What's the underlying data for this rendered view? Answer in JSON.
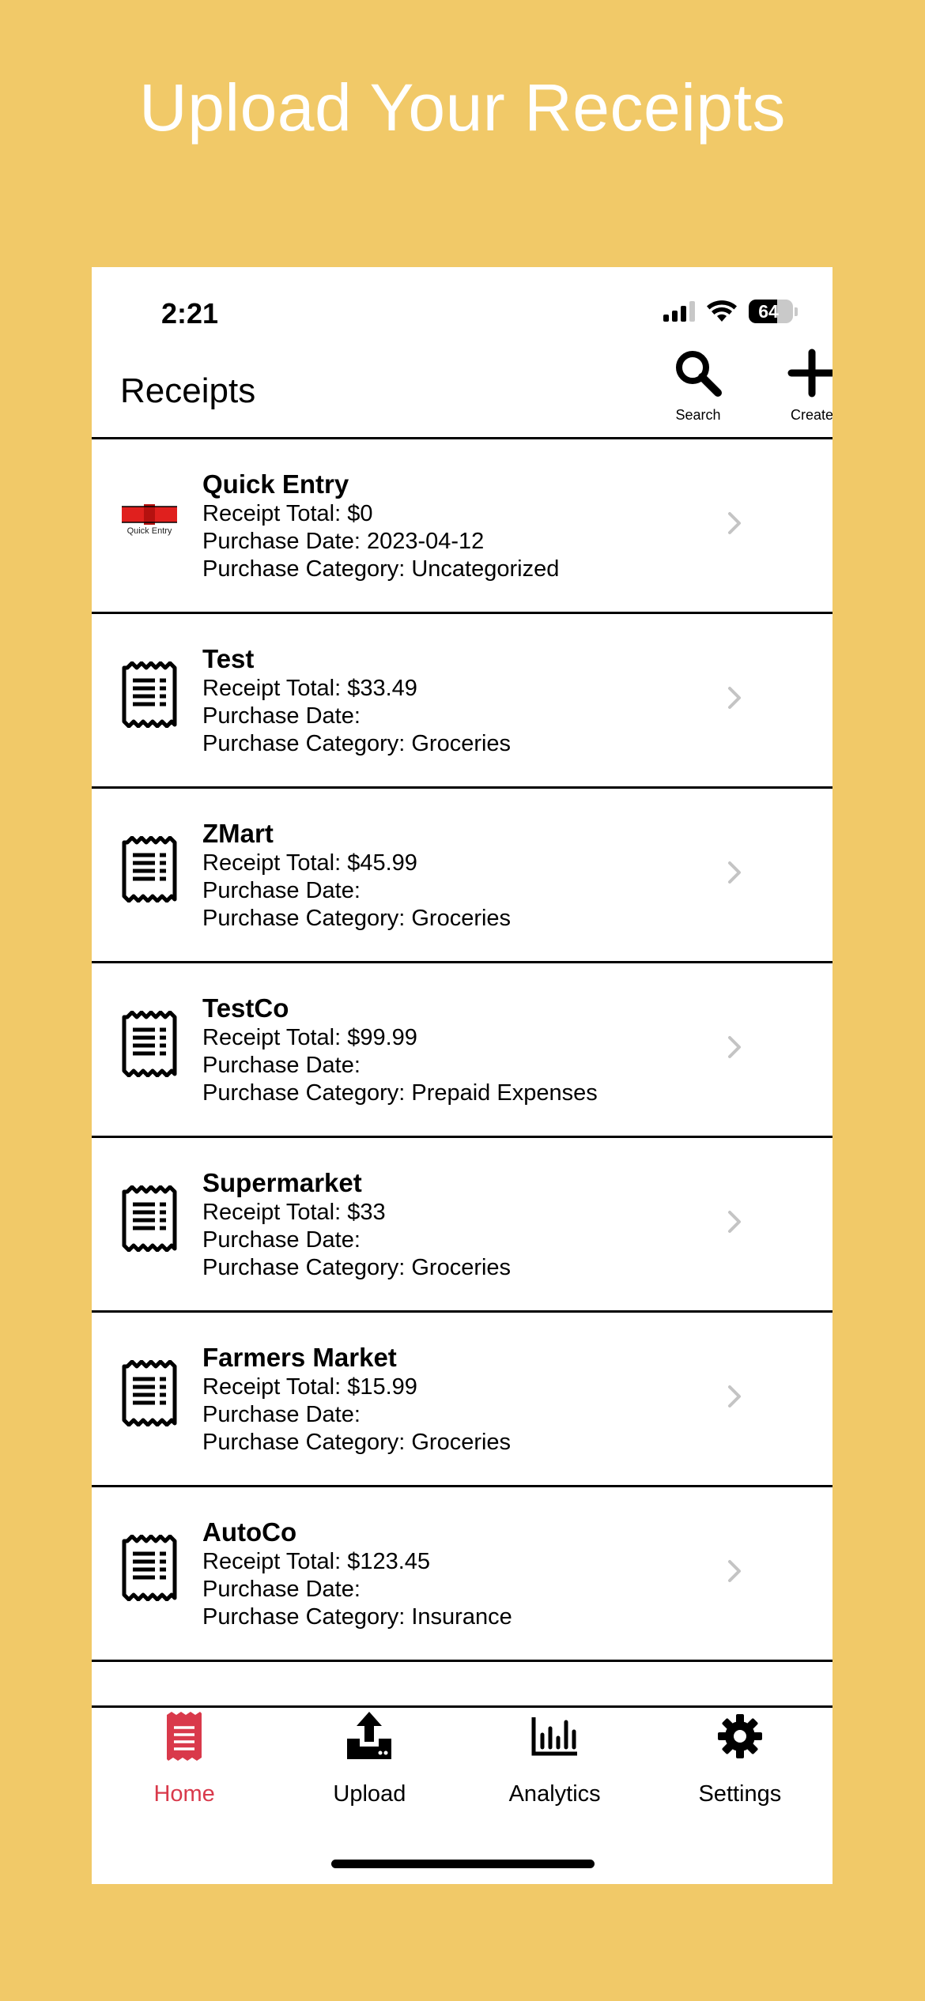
{
  "headline": "Upload Your Receipts",
  "status": {
    "time": "2:21",
    "battery": "64"
  },
  "nav": {
    "title": "Receipts",
    "search_label": "Search",
    "create_label": "Create"
  },
  "receipts": [
    {
      "name": "Quick Entry",
      "total": "Receipt Total: $0",
      "date": "Purchase Date: 2023-04-12",
      "category": "Purchase Category: Uncategorized",
      "icon": "quick-entry-logo",
      "logo_text": "Quick Entry"
    },
    {
      "name": "Test",
      "total": "Receipt Total: $33.49",
      "date": "Purchase Date:",
      "category": "Purchase Category: Groceries",
      "icon": "receipt-icon"
    },
    {
      "name": "ZMart",
      "total": "Receipt Total: $45.99",
      "date": "Purchase Date:",
      "category": "Purchase Category: Groceries",
      "icon": "receipt-icon"
    },
    {
      "name": "TestCo",
      "total": "Receipt Total: $99.99",
      "date": "Purchase Date:",
      "category": "Purchase Category: Prepaid Expenses",
      "icon": "receipt-icon"
    },
    {
      "name": "Supermarket",
      "total": "Receipt Total: $33",
      "date": "Purchase Date:",
      "category": "Purchase Category: Groceries",
      "icon": "receipt-icon"
    },
    {
      "name": "Farmers Market",
      "total": "Receipt Total: $15.99",
      "date": "Purchase Date:",
      "category": "Purchase Category: Groceries",
      "icon": "receipt-icon"
    },
    {
      "name": "AutoCo",
      "total": "Receipt Total: $123.45",
      "date": "Purchase Date:",
      "category": "Purchase Category: Insurance",
      "icon": "receipt-icon"
    }
  ],
  "tabs": [
    {
      "label": "Home",
      "icon": "receipt-icon",
      "active": true
    },
    {
      "label": "Upload",
      "icon": "upload-icon",
      "active": false
    },
    {
      "label": "Analytics",
      "icon": "bar-chart-icon",
      "active": false
    },
    {
      "label": "Settings",
      "icon": "gear-icon",
      "active": false
    }
  ],
  "colors": {
    "background": "#F1C968",
    "accent": "#D9394B",
    "logo_red": "#E0201E"
  }
}
